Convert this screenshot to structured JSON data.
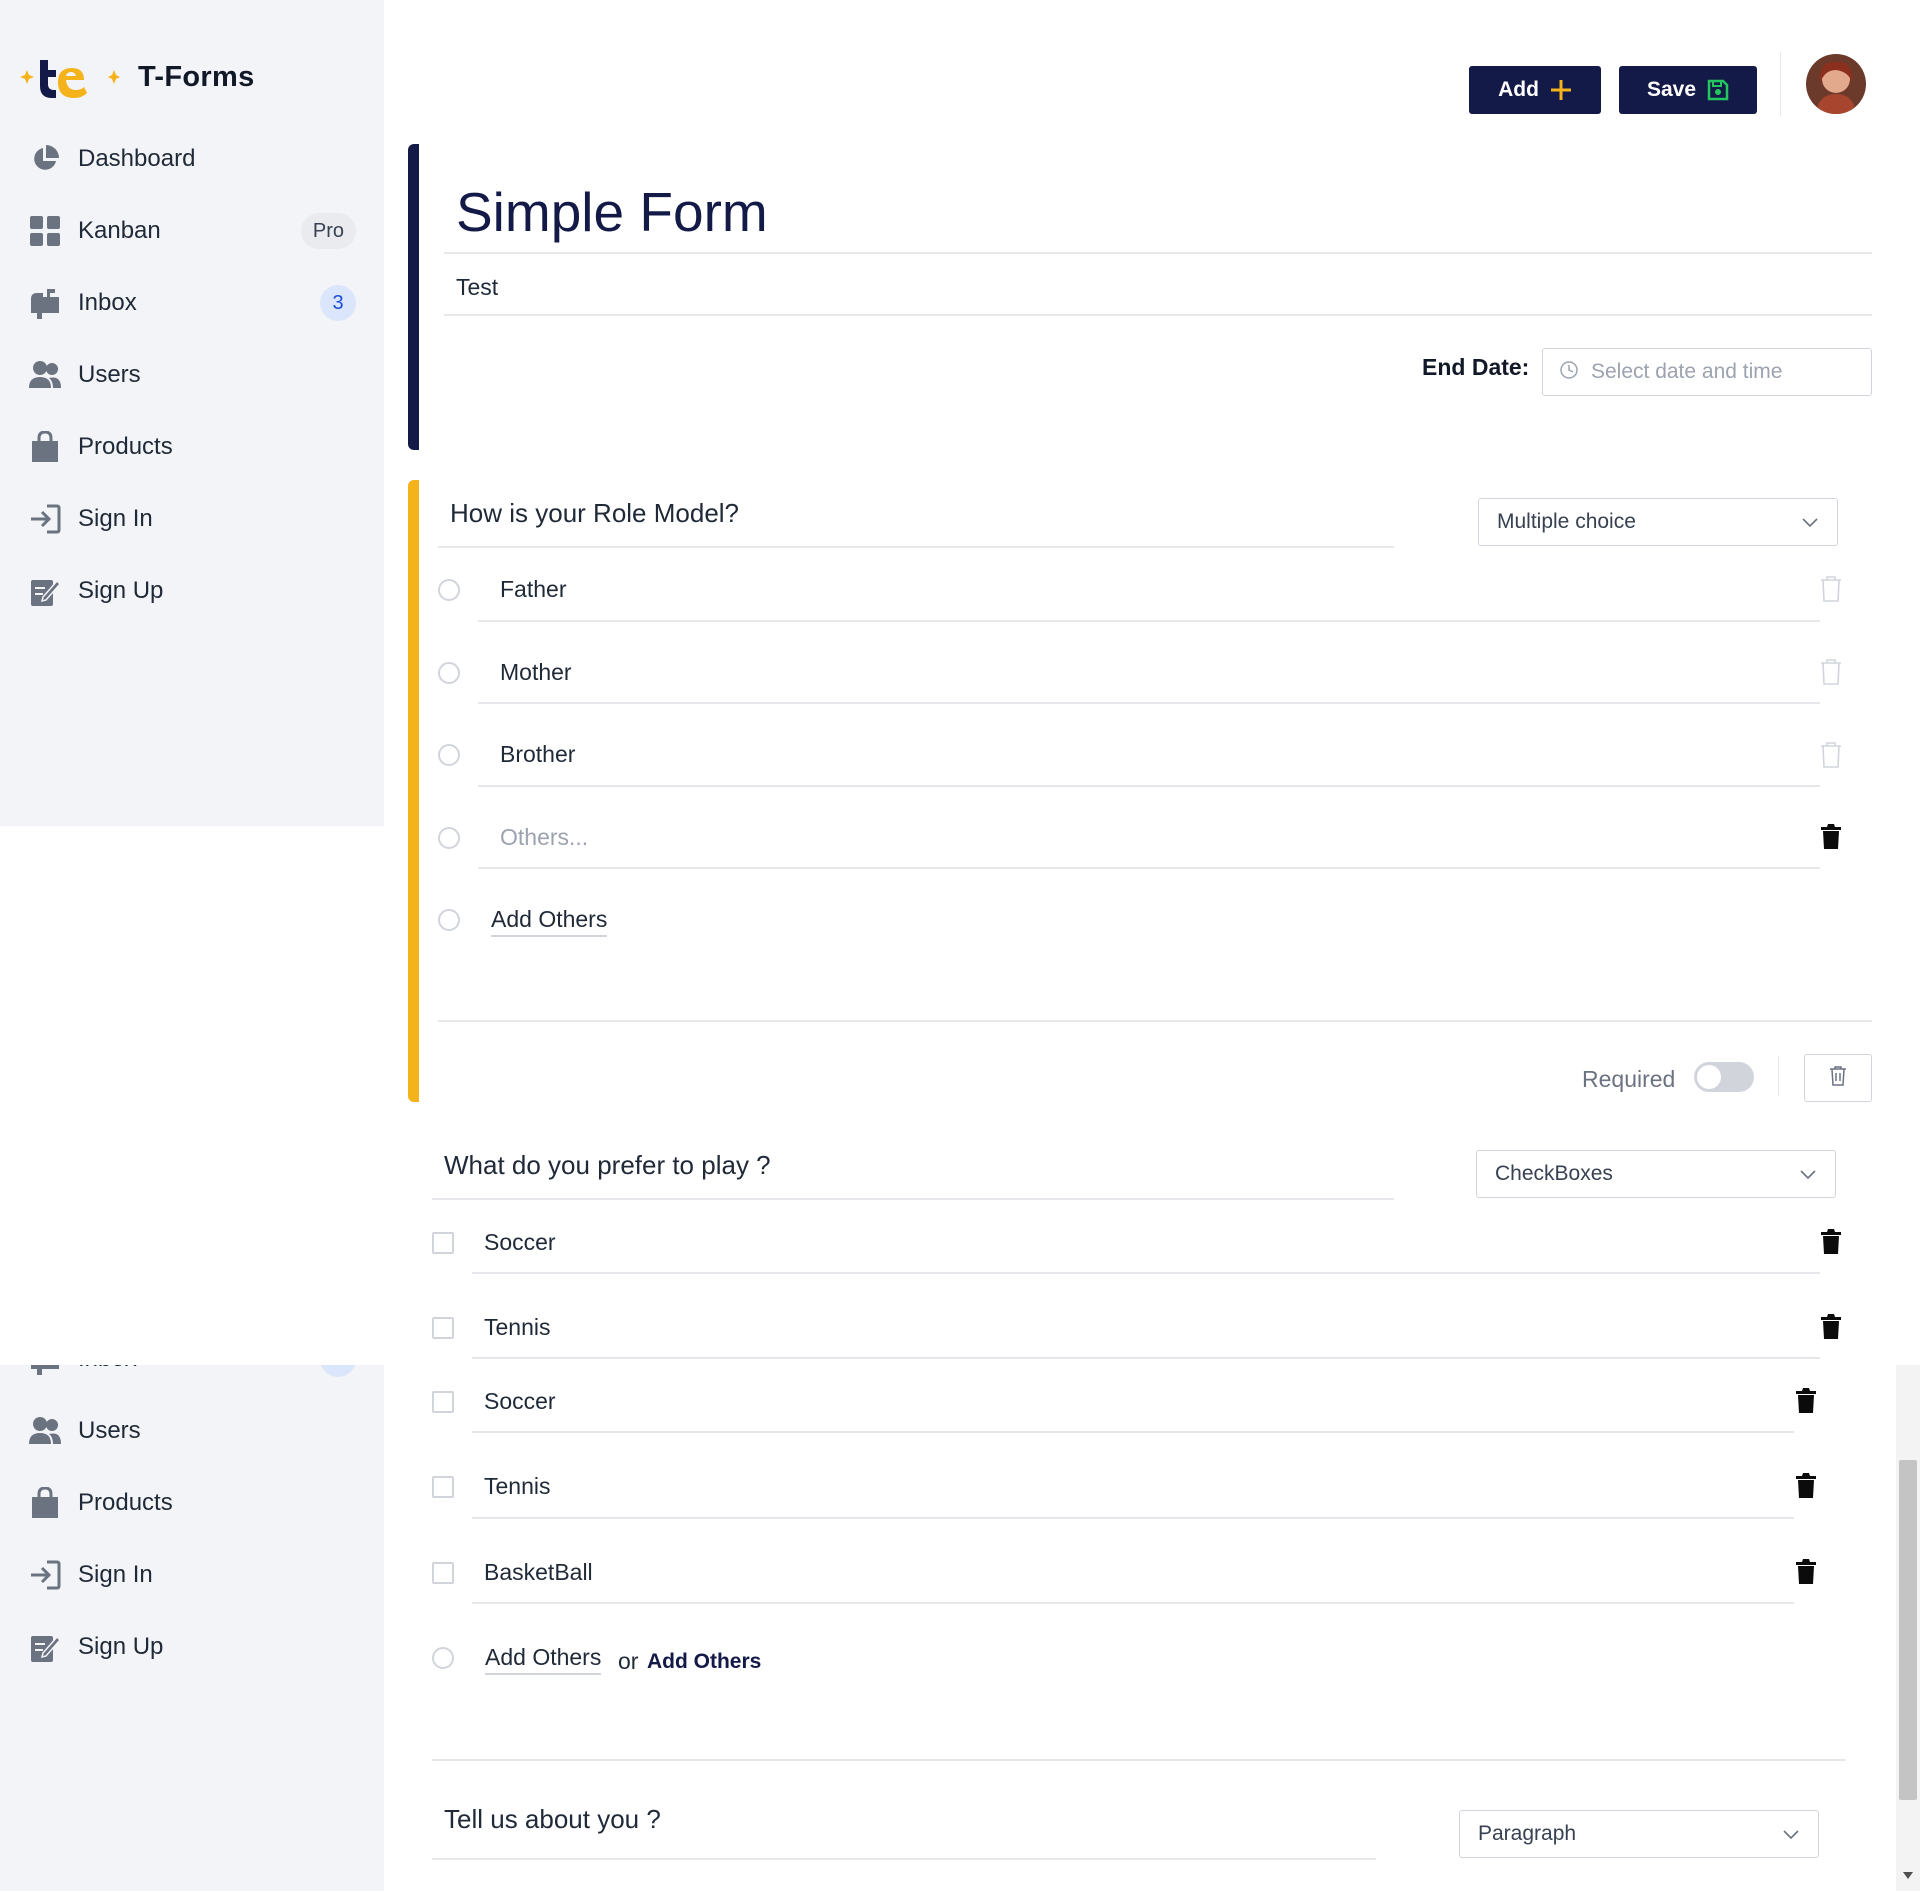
{
  "app": {
    "name": "T-Forms"
  },
  "sidebar": {
    "items": [
      {
        "label": "Dashboard",
        "icon": "pie-chart-icon"
      },
      {
        "label": "Kanban",
        "icon": "grid-icon",
        "badge": "Pro"
      },
      {
        "label": "Inbox",
        "icon": "mailbox-icon",
        "count": "3"
      },
      {
        "label": "Users",
        "icon": "users-icon"
      },
      {
        "label": "Products",
        "icon": "shopping-bag-icon"
      },
      {
        "label": "Sign In",
        "icon": "sign-in-icon"
      },
      {
        "label": "Sign Up",
        "icon": "sign-up-icon"
      }
    ]
  },
  "header": {
    "add_label": "Add",
    "save_label": "Save"
  },
  "form": {
    "title": "Simple Form",
    "description": "Test",
    "end_date_label": "End Date:",
    "end_date_placeholder": "Select date and time"
  },
  "questions": [
    {
      "title": "How is your Role Model?",
      "type": "Multiple choice",
      "options": [
        "Father",
        "Mother",
        "Brother"
      ],
      "other_placeholder": "Others...",
      "add_other_label": "Add Others",
      "required_label": "Required",
      "required": false
    },
    {
      "title": "What do you prefer to play ?",
      "type": "CheckBoxes",
      "options": [
        "Soccer",
        "Tennis",
        "Soccer",
        "Tennis",
        "BasketBall"
      ],
      "add_other_label": "Add Others",
      "or_label": "or",
      "add_other_bold_label": "Add Others"
    },
    {
      "title": "Tell us about you ?",
      "type": "Paragraph"
    }
  ],
  "colors": {
    "navy": "#141a47",
    "accent_yellow": "#f4b31a",
    "save_icon_green": "#22c55e",
    "badge_blue": "#1d4ed8"
  }
}
